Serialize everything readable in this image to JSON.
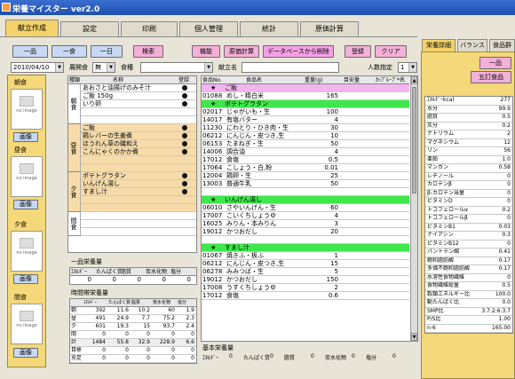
{
  "app": {
    "title": "栄養マイスター ver2.0"
  },
  "tabs": [
    "献立作成",
    "設定",
    "印刷",
    "個人管理",
    "統計",
    "原価計算"
  ],
  "toolbar": {
    "period": [
      "一品",
      "一食",
      "一日"
    ],
    "search": "検索",
    "actions": [
      "機能",
      "原価計算",
      "データベースから削除",
      "登録",
      "クリア"
    ]
  },
  "filters": {
    "date": "2010/04/10",
    "staff_label": "展開食",
    "staff_value": "無",
    "meal_label": "食種",
    "menu_name_label": "献立名",
    "people_label": "人数指定",
    "people_value": "1"
  },
  "meals": [
    {
      "label": "朝食",
      "no_image": "no image",
      "button": "画像"
    },
    {
      "label": "昼食",
      "no_image": "no image",
      "button": "画像"
    },
    {
      "label": "夕食",
      "no_image": "no image",
      "button": "画像"
    },
    {
      "label": "間食",
      "no_image": "no image",
      "button": "画像"
    }
  ],
  "menu_list": {
    "headers": [
      "種類",
      "名称",
      "登録"
    ],
    "groups": [
      {
        "name": "朝食",
        "items": [
          {
            "name": "あおさと油揚げのみそ汁",
            "reg": true
          },
          {
            "name": "ご飯 150g",
            "reg": true
          },
          {
            "name": "いり卵",
            "reg": true
          }
        ]
      },
      {
        "name": "昼食",
        "items": [
          {
            "name": "ご飯",
            "reg": true
          },
          {
            "name": "鶏レバーの生姜煮",
            "reg": true
          },
          {
            "name": "ほうれん草の磯和え",
            "reg": true
          },
          {
            "name": "こんにゃくのかか煮",
            "reg": true
          }
        ]
      },
      {
        "name": "夕食",
        "items": [
          {
            "name": "ポテトグラタン",
            "reg": true
          },
          {
            "name": "いんげん湯し",
            "reg": true
          },
          {
            "name": "すまし汁",
            "reg": true
          }
        ]
      },
      {
        "name": "間食",
        "items": []
      }
    ]
  },
  "ingredients": {
    "headers": [
      "食品No.",
      "食品名",
      "重量(g)",
      "目安量",
      "ｶｯﾌﾟﾙｰﾌﾟ*名"
    ],
    "sections": [
      {
        "title": "ご飯",
        "color": "#f4b4f0",
        "rows": [
          {
            "no": "01088",
            "name": "めし・精白米",
            "weight": "165"
          }
        ]
      },
      {
        "title": "ポテトグラタン",
        "color": "#3ee84a",
        "rows": [
          {
            "no": "02017",
            "name": "じゃがいも・生",
            "weight": "100"
          },
          {
            "no": "14017",
            "name": "有塩バター",
            "weight": "4"
          },
          {
            "no": "11230",
            "name": "にわとり・ひき肉・生",
            "weight": "30"
          },
          {
            "no": "06212",
            "name": "にんじん・皮つき,生",
            "weight": "10"
          },
          {
            "no": "06153",
            "name": "たまねぎ・生",
            "weight": "50"
          },
          {
            "no": "14006",
            "name": "調合油",
            "weight": "4"
          },
          {
            "no": "17012",
            "name": "食塩",
            "weight": "0.5"
          },
          {
            "no": "17064",
            "name": "こしょう・白,粉",
            "weight": "0.01"
          },
          {
            "no": "12004",
            "name": "鶏卵・生",
            "weight": "25"
          },
          {
            "no": "13003",
            "name": "普通牛乳",
            "weight": "50"
          },
          {
            "no": "",
            "name": "",
            "weight": ""
          }
        ]
      },
      {
        "title": "いんげん湯し",
        "color": "#3ee84a",
        "rows": [
          {
            "no": "06010",
            "name": "さやいんげん・生",
            "weight": "60"
          },
          {
            "no": "17007",
            "name": "こいくちしょうゆ",
            "weight": "4"
          },
          {
            "no": "16025",
            "name": "みりん・本みりん",
            "weight": "3"
          },
          {
            "no": "19012",
            "name": "かつおだし",
            "weight": "20"
          },
          {
            "no": "",
            "name": "",
            "weight": ""
          }
        ]
      },
      {
        "title": "すまし汁",
        "color": "#3ee84a",
        "rows": [
          {
            "no": "01067",
            "name": "焼きふ・板ふ",
            "weight": "1"
          },
          {
            "no": "06212",
            "name": "にんじん・皮つき,生",
            "weight": "15"
          },
          {
            "no": "06278",
            "name": "みみつば・生",
            "weight": "5"
          },
          {
            "no": "19012",
            "name": "かつおだし",
            "weight": "150"
          },
          {
            "no": "17008",
            "name": "うすくちしょうゆ",
            "weight": "2"
          },
          {
            "no": "17012",
            "name": "食塩",
            "weight": "0.6"
          }
        ]
      }
    ]
  },
  "ippin": {
    "title": "一品栄養量",
    "headers": [
      "ｴﾈﾙｷﾞｰ",
      "たんぱく質",
      "脂質",
      "炭水化物",
      "塩分"
    ],
    "values": [
      "0",
      "0",
      "0",
      "0",
      "0"
    ]
  },
  "meal_nutrition": {
    "title": "時間帯栄養量",
    "headers": [
      "",
      "ｴﾈﾙｷﾞｰ",
      "たんぱく質",
      "脂質",
      "炭水化物",
      "塩分"
    ],
    "rows": [
      [
        "朝",
        "392",
        "11.6",
        "10.2",
        "60",
        "1.9"
      ],
      [
        "昼",
        "491",
        "24.9",
        "7.7",
        "75.2",
        "2.3"
      ],
      [
        "夕",
        "601",
        "19.3",
        "15",
        "93.7",
        "2.4"
      ],
      [
        "間",
        "0",
        "0",
        "0",
        "0",
        "0"
      ],
      [
        "計",
        "1484",
        "55.8",
        "32.9",
        "228.9",
        "6.6"
      ],
      [
        "目標値",
        "0",
        "0",
        "0",
        "0",
        "0"
      ],
      [
        "充足率",
        "0",
        "0",
        "0",
        "0",
        "0"
      ]
    ]
  },
  "basic_nutrition": {
    "title": "基本栄養量",
    "headers": [
      "ｴﾈﾙｷﾞｰ",
      "0",
      "たんぱく質",
      "0",
      "脂質",
      "0",
      "炭水化物",
      "0",
      "塩分",
      "0"
    ]
  },
  "right_panel": {
    "tabs": [
      "栄養詳細",
      "バランス",
      "食品群"
    ],
    "buttons": [
      "一品",
      "五訂食品"
    ],
    "nutrients": [
      [
        "ｴﾈﾙｷﾞｰkcal",
        "277"
      ],
      [
        "水分",
        "99.9"
      ],
      [
        "脂質",
        "0.5"
      ],
      [
        "灰分",
        "0.2"
      ],
      [
        "ナトリウム",
        "2"
      ],
      [
        "マグネシウム",
        "12"
      ],
      [
        "リン",
        "56"
      ],
      [
        "亜鉛",
        "1.0"
      ],
      [
        "マンガン",
        "0.58"
      ],
      [
        "レチノール",
        "0"
      ],
      [
        "カロテンβ",
        "0"
      ],
      [
        "β-カロテン当量",
        "0"
      ],
      [
        "ビタミンD",
        "0"
      ],
      [
        "トコフェロールα",
        "0.2"
      ],
      [
        "トコフェロールβ",
        "0"
      ],
      [
        "ビタミンB1",
        "0.03"
      ],
      [
        "ナイアシン",
        "0.3"
      ],
      [
        "ビタミンB12",
        "0"
      ],
      [
        "パントテン酸",
        "0.41"
      ],
      [
        "飽和脂肪酸",
        "0.17"
      ],
      [
        "多価不飽和脂肪酸",
        "0.17"
      ],
      [
        "水溶性食物繊維",
        "0"
      ],
      [
        "食物繊維総量",
        "0.5"
      ],
      [
        "穀類エネルギー比",
        "100.0"
      ],
      [
        "動たんぱく比",
        "0.0"
      ],
      [
        "SMP比",
        "3.7:2.6:3.7"
      ],
      [
        "P/S比",
        "1.00"
      ],
      [
        "n-6",
        "165.00"
      ]
    ]
  }
}
